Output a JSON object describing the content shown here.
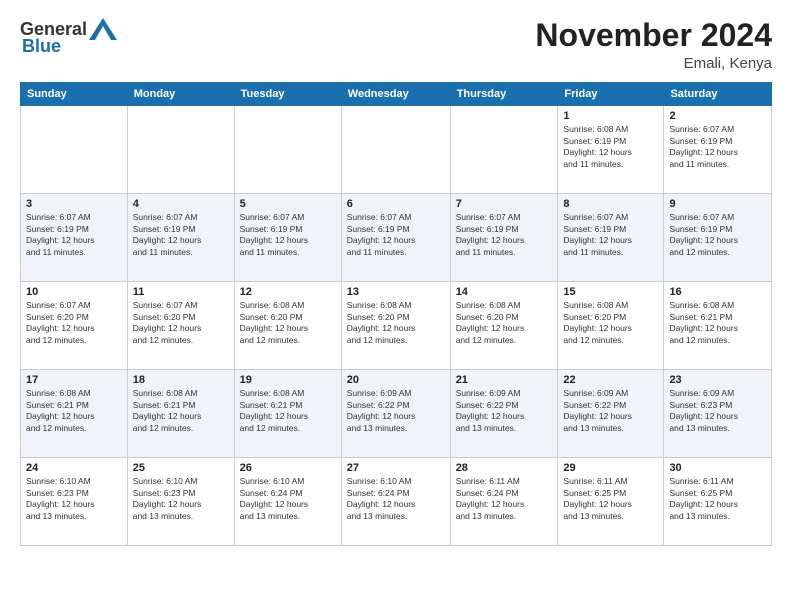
{
  "logo": {
    "general": "General",
    "blue": "Blue"
  },
  "header": {
    "month": "November 2024",
    "location": "Emali, Kenya"
  },
  "weekdays": [
    "Sunday",
    "Monday",
    "Tuesday",
    "Wednesday",
    "Thursday",
    "Friday",
    "Saturday"
  ],
  "weeks": [
    [
      {
        "day": "",
        "info": ""
      },
      {
        "day": "",
        "info": ""
      },
      {
        "day": "",
        "info": ""
      },
      {
        "day": "",
        "info": ""
      },
      {
        "day": "",
        "info": ""
      },
      {
        "day": "1",
        "info": "Sunrise: 6:08 AM\nSunset: 6:19 PM\nDaylight: 12 hours\nand 11 minutes."
      },
      {
        "day": "2",
        "info": "Sunrise: 6:07 AM\nSunset: 6:19 PM\nDaylight: 12 hours\nand 11 minutes."
      }
    ],
    [
      {
        "day": "3",
        "info": "Sunrise: 6:07 AM\nSunset: 6:19 PM\nDaylight: 12 hours\nand 11 minutes."
      },
      {
        "day": "4",
        "info": "Sunrise: 6:07 AM\nSunset: 6:19 PM\nDaylight: 12 hours\nand 11 minutes."
      },
      {
        "day": "5",
        "info": "Sunrise: 6:07 AM\nSunset: 6:19 PM\nDaylight: 12 hours\nand 11 minutes."
      },
      {
        "day": "6",
        "info": "Sunrise: 6:07 AM\nSunset: 6:19 PM\nDaylight: 12 hours\nand 11 minutes."
      },
      {
        "day": "7",
        "info": "Sunrise: 6:07 AM\nSunset: 6:19 PM\nDaylight: 12 hours\nand 11 minutes."
      },
      {
        "day": "8",
        "info": "Sunrise: 6:07 AM\nSunset: 6:19 PM\nDaylight: 12 hours\nand 11 minutes."
      },
      {
        "day": "9",
        "info": "Sunrise: 6:07 AM\nSunset: 6:19 PM\nDaylight: 12 hours\nand 12 minutes."
      }
    ],
    [
      {
        "day": "10",
        "info": "Sunrise: 6:07 AM\nSunset: 6:20 PM\nDaylight: 12 hours\nand 12 minutes."
      },
      {
        "day": "11",
        "info": "Sunrise: 6:07 AM\nSunset: 6:20 PM\nDaylight: 12 hours\nand 12 minutes."
      },
      {
        "day": "12",
        "info": "Sunrise: 6:08 AM\nSunset: 6:20 PM\nDaylight: 12 hours\nand 12 minutes."
      },
      {
        "day": "13",
        "info": "Sunrise: 6:08 AM\nSunset: 6:20 PM\nDaylight: 12 hours\nand 12 minutes."
      },
      {
        "day": "14",
        "info": "Sunrise: 6:08 AM\nSunset: 6:20 PM\nDaylight: 12 hours\nand 12 minutes."
      },
      {
        "day": "15",
        "info": "Sunrise: 6:08 AM\nSunset: 6:20 PM\nDaylight: 12 hours\nand 12 minutes."
      },
      {
        "day": "16",
        "info": "Sunrise: 6:08 AM\nSunset: 6:21 PM\nDaylight: 12 hours\nand 12 minutes."
      }
    ],
    [
      {
        "day": "17",
        "info": "Sunrise: 6:08 AM\nSunset: 6:21 PM\nDaylight: 12 hours\nand 12 minutes."
      },
      {
        "day": "18",
        "info": "Sunrise: 6:08 AM\nSunset: 6:21 PM\nDaylight: 12 hours\nand 12 minutes."
      },
      {
        "day": "19",
        "info": "Sunrise: 6:08 AM\nSunset: 6:21 PM\nDaylight: 12 hours\nand 12 minutes."
      },
      {
        "day": "20",
        "info": "Sunrise: 6:09 AM\nSunset: 6:22 PM\nDaylight: 12 hours\nand 13 minutes."
      },
      {
        "day": "21",
        "info": "Sunrise: 6:09 AM\nSunset: 6:22 PM\nDaylight: 12 hours\nand 13 minutes."
      },
      {
        "day": "22",
        "info": "Sunrise: 6:09 AM\nSunset: 6:22 PM\nDaylight: 12 hours\nand 13 minutes."
      },
      {
        "day": "23",
        "info": "Sunrise: 6:09 AM\nSunset: 6:23 PM\nDaylight: 12 hours\nand 13 minutes."
      }
    ],
    [
      {
        "day": "24",
        "info": "Sunrise: 6:10 AM\nSunset: 6:23 PM\nDaylight: 12 hours\nand 13 minutes."
      },
      {
        "day": "25",
        "info": "Sunrise: 6:10 AM\nSunset: 6:23 PM\nDaylight: 12 hours\nand 13 minutes."
      },
      {
        "day": "26",
        "info": "Sunrise: 6:10 AM\nSunset: 6:24 PM\nDaylight: 12 hours\nand 13 minutes."
      },
      {
        "day": "27",
        "info": "Sunrise: 6:10 AM\nSunset: 6:24 PM\nDaylight: 12 hours\nand 13 minutes."
      },
      {
        "day": "28",
        "info": "Sunrise: 6:11 AM\nSunset: 6:24 PM\nDaylight: 12 hours\nand 13 minutes."
      },
      {
        "day": "29",
        "info": "Sunrise: 6:11 AM\nSunset: 6:25 PM\nDaylight: 12 hours\nand 13 minutes."
      },
      {
        "day": "30",
        "info": "Sunrise: 6:11 AM\nSunset: 6:25 PM\nDaylight: 12 hours\nand 13 minutes."
      }
    ]
  ]
}
